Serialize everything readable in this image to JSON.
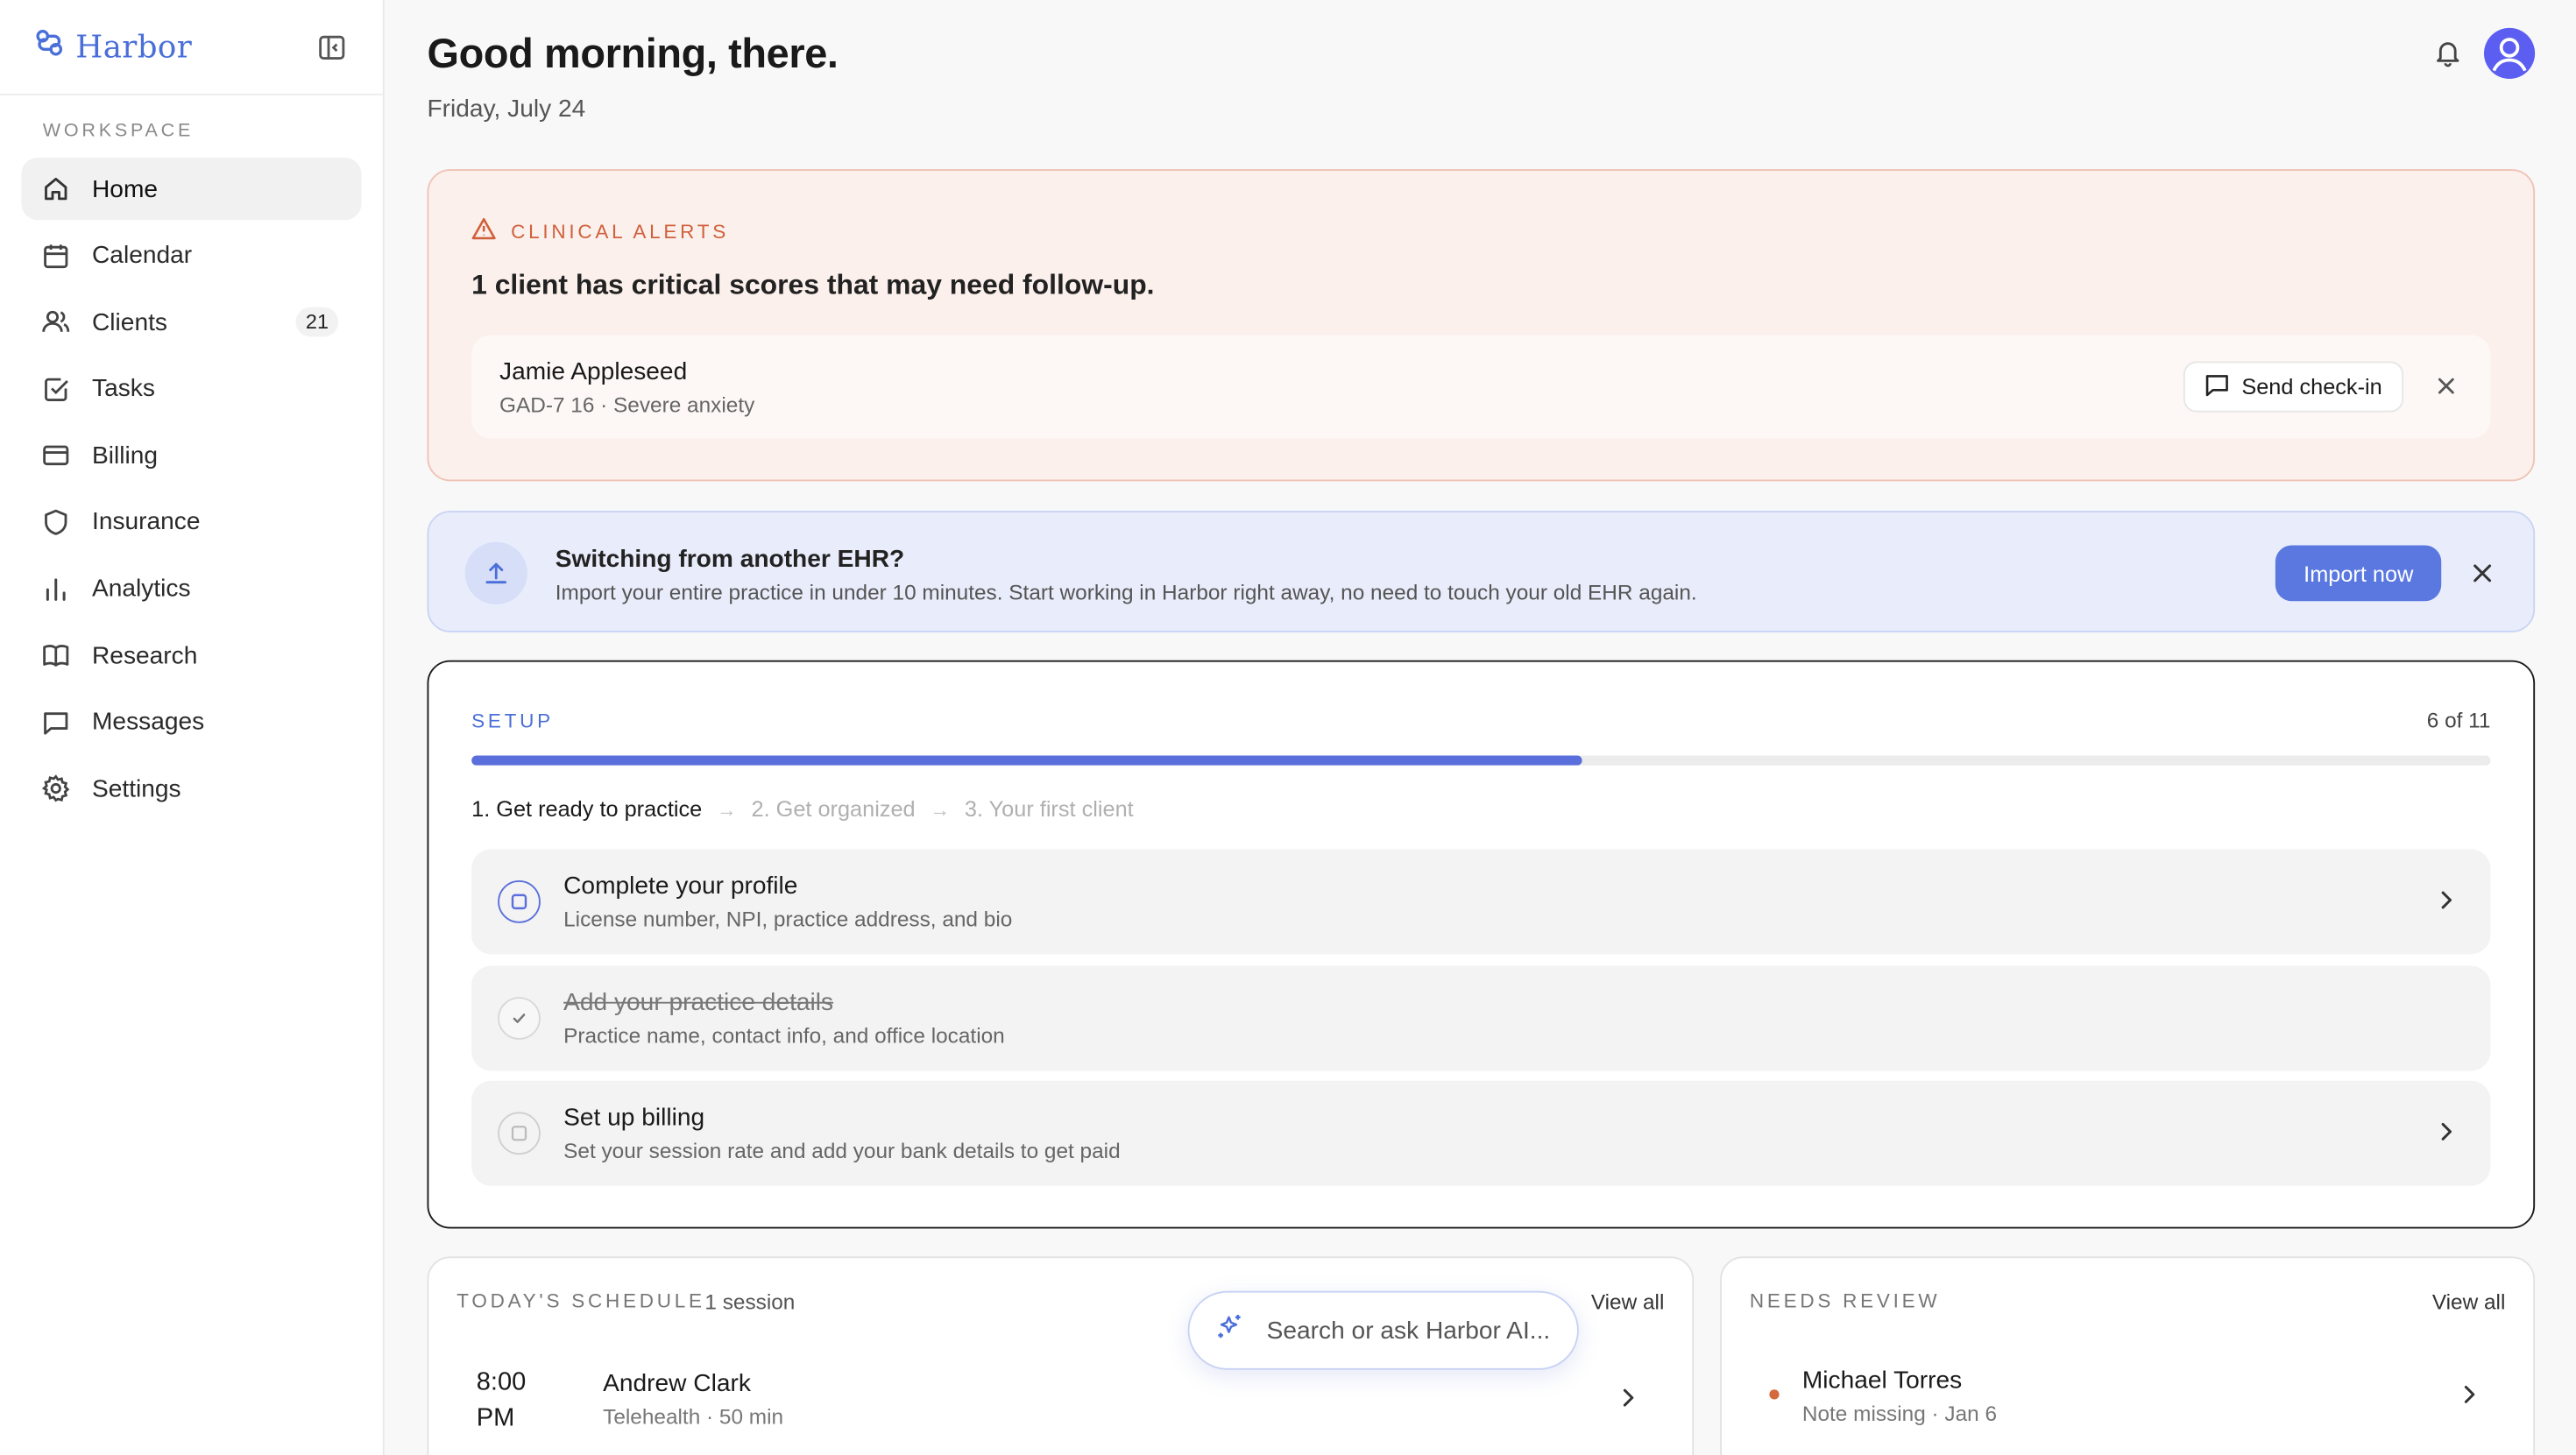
{
  "brand": {
    "name": "Harbor"
  },
  "sidebar": {
    "section_label": "WORKSPACE",
    "items": [
      {
        "label": "Home",
        "icon": "home-icon"
      },
      {
        "label": "Calendar",
        "icon": "calendar-icon"
      },
      {
        "label": "Clients",
        "icon": "users-icon",
        "badge": "21"
      },
      {
        "label": "Tasks",
        "icon": "checkbox-icon"
      },
      {
        "label": "Billing",
        "icon": "credit-card-icon"
      },
      {
        "label": "Insurance",
        "icon": "shield-icon"
      },
      {
        "label": "Analytics",
        "icon": "bar-chart-icon"
      },
      {
        "label": "Research",
        "icon": "book-icon"
      },
      {
        "label": "Messages",
        "icon": "message-icon"
      },
      {
        "label": "Settings",
        "icon": "gear-icon"
      }
    ]
  },
  "header": {
    "greeting": "Good morning, there.",
    "date": "Friday, July 24"
  },
  "alerts": {
    "label": "CLINICAL ALERTS",
    "headline": "1 client has critical scores that may need follow-up.",
    "client_name": "Jamie Appleseed",
    "client_detail": "GAD-7 16 · Severe anxiety",
    "checkin_label": "Send check-in"
  },
  "ehr": {
    "title": "Switching from another EHR?",
    "subtitle": "Import your entire practice in under 10 minutes. Start working in Harbor right away, no need to touch your old EHR again.",
    "button": "Import now"
  },
  "setup": {
    "label": "SETUP",
    "count": "6 of 11",
    "progress": 0.55,
    "steps": [
      "1. Get ready to practice",
      "2. Get organized",
      "3. Your first client"
    ],
    "tasks": [
      {
        "title": "Complete your profile",
        "desc": "License number, NPI, practice address, and bio",
        "state": "current"
      },
      {
        "title": "Add your practice details",
        "desc": "Practice name, contact info, and office location",
        "state": "done"
      },
      {
        "title": "Set up billing",
        "desc": "Set your session rate and add your bank details to get paid",
        "state": "todo"
      }
    ]
  },
  "schedule": {
    "label": "TODAY'S SCHEDULE",
    "sub": "1 session",
    "view_all": "View all",
    "time_line1": "8:00",
    "time_line2": "PM",
    "name": "Andrew Clark",
    "detail": "Telehealth · 50 min"
  },
  "review": {
    "label": "NEEDS REVIEW",
    "view_all": "View all",
    "name": "Michael Torres",
    "detail": "Note missing · Jan 6"
  },
  "ai_search": {
    "placeholder": "Search or ask Harbor AI..."
  },
  "colors": {
    "accent": "#5a78e0",
    "alert": "#d0603c",
    "avatar": "#5b5ef0"
  }
}
